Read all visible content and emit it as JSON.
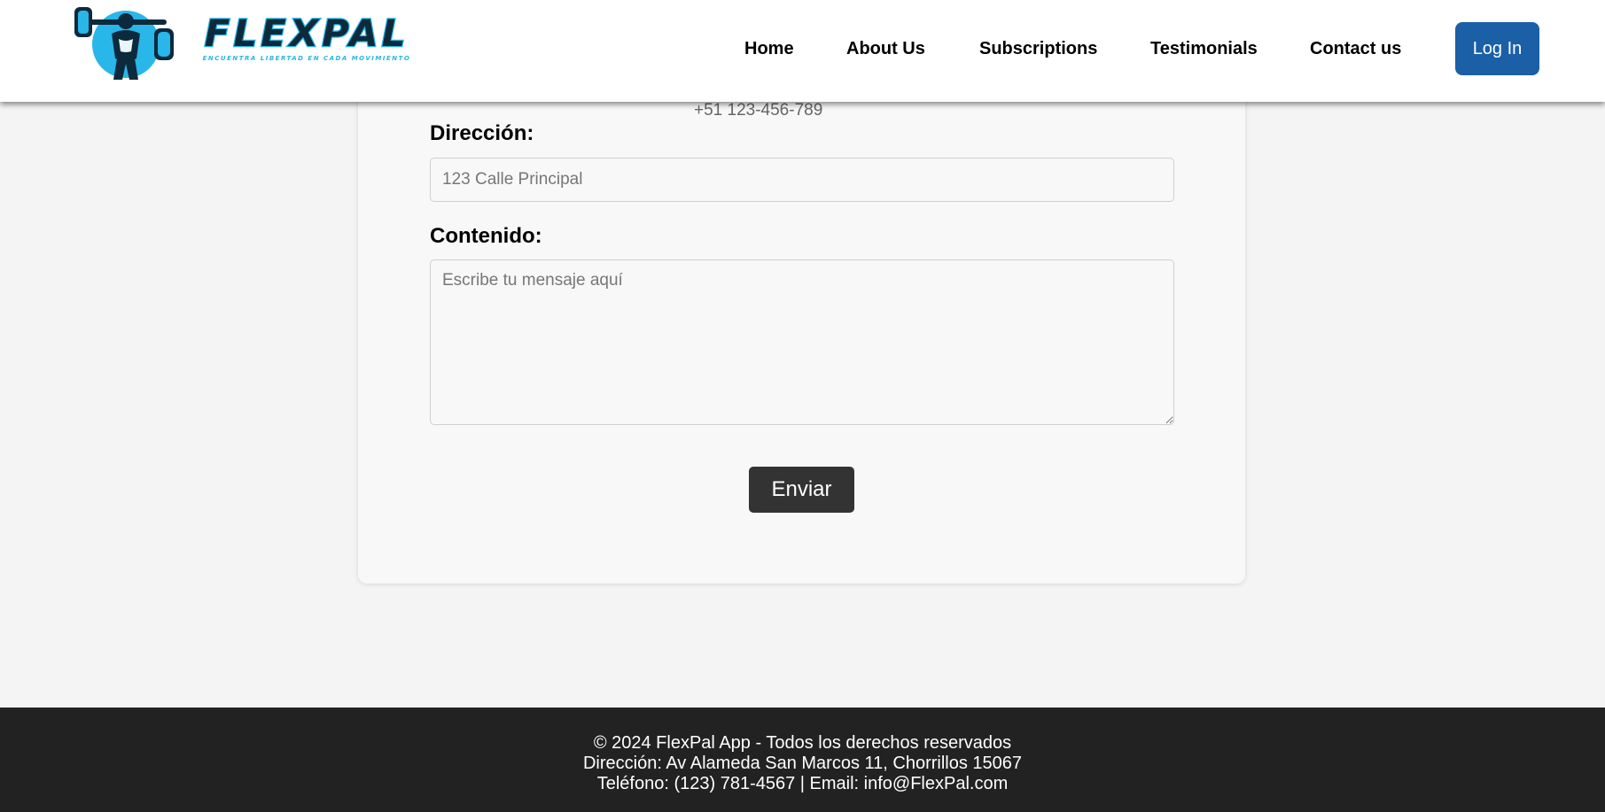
{
  "brand": {
    "name": "FLEXPAL",
    "tagline": "ENCUENTRA LIBERTAD EN CADA MOVIMIENTO",
    "accent_color": "#29b6e8",
    "dark_color": "#0d2a3d"
  },
  "nav": {
    "items": [
      {
        "label": "Home"
      },
      {
        "label": "About Us"
      },
      {
        "label": "Subscriptions"
      },
      {
        "label": "Testimonials"
      },
      {
        "label": "Contact us"
      }
    ],
    "login_label": "Log In",
    "login_color": "#1b5fa6"
  },
  "form": {
    "phone_value": "+51 123-456-789",
    "direccion_label": "Dirección:",
    "direccion_placeholder": "123 Calle Principal",
    "direccion_value": "",
    "contenido_label": "Contenido:",
    "contenido_placeholder": "Escribe tu mensaje aquí",
    "contenido_value": "",
    "submit_label": "Enviar"
  },
  "footer": {
    "copyright": "© 2024 FlexPal App - Todos los derechos reservados",
    "address": "Dirección: Av Alameda San Marcos 11, Chorrillos 15067",
    "contact": "Teléfono: (123) 781-4567 | Email: info@FlexPal.com"
  }
}
